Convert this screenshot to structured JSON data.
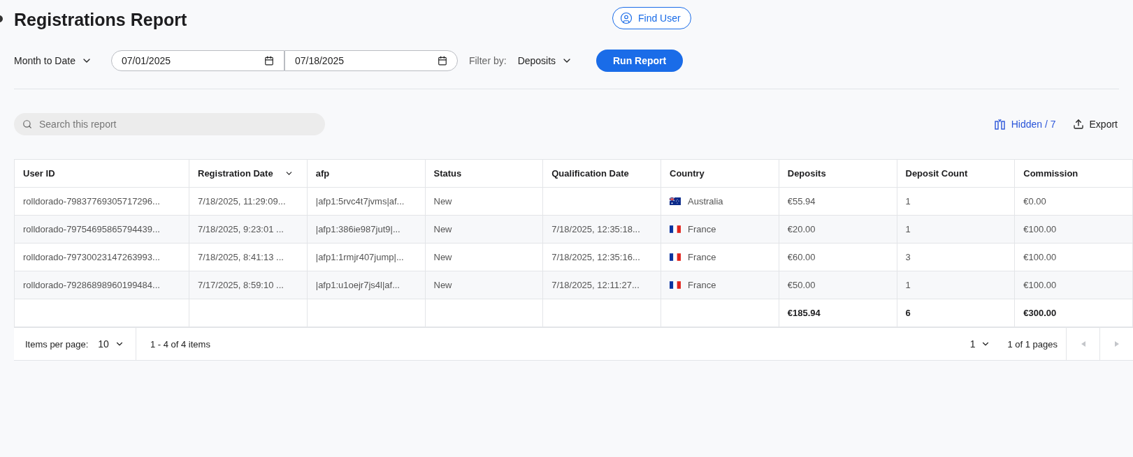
{
  "header": {
    "title": "Registrations Report",
    "find_user": "Find User"
  },
  "controls": {
    "range": "Month to Date",
    "date_from": "07/01/2025",
    "date_to": "07/18/2025",
    "filter_label": "Filter by:",
    "filter_value": "Deposits",
    "run": "Run Report"
  },
  "toolbar": {
    "search_placeholder": "Search this report",
    "hidden": "Hidden / 7",
    "export": "Export"
  },
  "table": {
    "columns": [
      {
        "label": "User ID",
        "sorted": false
      },
      {
        "label": "Registration Date",
        "sorted": true
      },
      {
        "label": "afp",
        "sorted": false
      },
      {
        "label": "Status",
        "sorted": false
      },
      {
        "label": "Qualification Date",
        "sorted": false
      },
      {
        "label": "Country",
        "sorted": false
      },
      {
        "label": "Deposits",
        "sorted": false
      },
      {
        "label": "Deposit Count",
        "sorted": false
      },
      {
        "label": "Commission",
        "sorted": false
      }
    ],
    "rows": [
      {
        "user_id": "rolldorado-79837769305717296...",
        "registration_date": "7/18/2025, 11:29:09...",
        "afp": "|afp1:5rvc4t7jvms|af...",
        "status": "New",
        "country": {
          "name": "Australia",
          "kind": "au"
        },
        "deposits": "€55.94",
        "deposit_count": "1",
        "commission": "€0.00"
      },
      {
        "user_id": "rolldorado-79754695865794439...",
        "registration_date": "7/18/2025, 9:23:01 ...",
        "afp": "|afp1:386ie987jut9|...",
        "status": "New",
        "qualification_date": "7/18/2025, 12:35:18...",
        "country": {
          "name": "France",
          "kind": "fr"
        },
        "deposits": "€20.00",
        "deposit_count": "1",
        "commission": "€100.00"
      },
      {
        "user_id": "rolldorado-79730023147263993...",
        "registration_date": "7/18/2025, 8:41:13 ...",
        "afp": "|afp1:1rmjr407jump|...",
        "status": "New",
        "qualification_date": "7/18/2025, 12:35:16...",
        "country": {
          "name": "France",
          "kind": "fr"
        },
        "deposits": "€60.00",
        "deposit_count": "3",
        "commission": "€100.00"
      },
      {
        "user_id": "rolldorado-79286898960199484...",
        "registration_date": "7/17/2025, 8:59:10 ...",
        "afp": "|afp1:u1oejr7js4l|af...",
        "status": "New",
        "qualification_date": "7/18/2025, 12:11:27...",
        "country": {
          "name": "France",
          "kind": "fr"
        },
        "deposits": "€50.00",
        "deposit_count": "1",
        "commission": "€100.00"
      }
    ],
    "totals": {
      "deposits": "€185.94",
      "deposit_count": "6",
      "commission": "€300.00"
    }
  },
  "pagination": {
    "items_per_page_label": "Items per page:",
    "items_per_page": "10",
    "range": "1 - 4 of 4 items",
    "page": "1",
    "pages": "1 of 1 pages",
    "prev_disabled": true,
    "next_disabled": true
  }
}
